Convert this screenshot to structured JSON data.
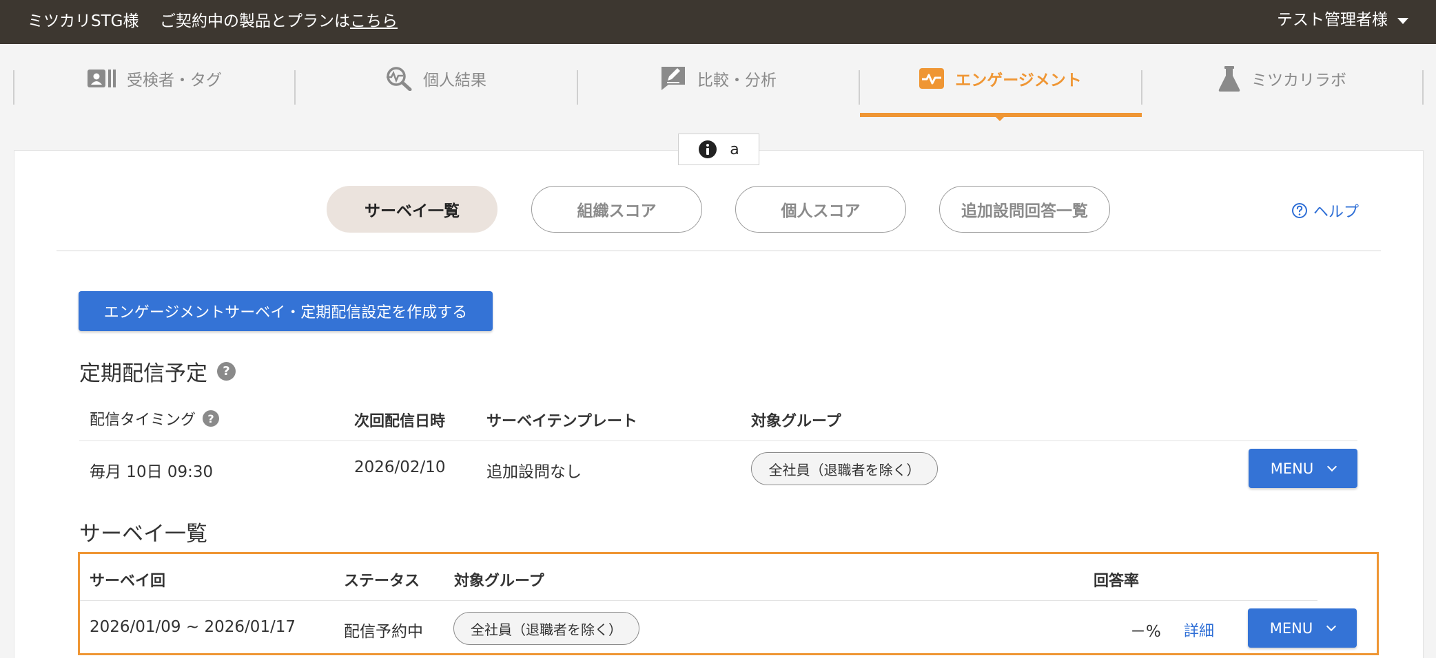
{
  "topbar": {
    "company": "ミツカリSTG様",
    "plan_text": "ご契約中の製品とプランは",
    "plan_link": "こちら",
    "user": "テスト管理者様"
  },
  "nav": {
    "tabs": [
      {
        "label": "受検者・タグ",
        "icon": "id-card-icon"
      },
      {
        "label": "個人結果",
        "icon": "magnify-pulse-icon"
      },
      {
        "label": "比較・分析",
        "icon": "chat-pencil-icon"
      },
      {
        "label": "エンゲージメント",
        "icon": "pulse-icon",
        "active": true
      },
      {
        "label": "ミツカリラボ",
        "icon": "flask-icon"
      }
    ]
  },
  "info_badge": {
    "text": "a"
  },
  "subtabs": [
    {
      "label": "サーベイ一覧",
      "active": true
    },
    {
      "label": "組織スコア"
    },
    {
      "label": "個人スコア"
    },
    {
      "label": "追加設問回答一覧"
    }
  ],
  "help_label": "ヘルプ",
  "create_button": "エンゲージメントサーベイ・定期配信設定を作成する",
  "schedule": {
    "title": "定期配信予定",
    "columns": [
      "配信タイミング",
      "次回配信日時",
      "サーベイテンプレート",
      "対象グループ"
    ],
    "rows": [
      {
        "timing": "毎月 10日 09:30",
        "next": "2026/02/10",
        "template": "追加設問なし",
        "group": "全社員（退職者を除く）",
        "menu": "MENU"
      }
    ]
  },
  "surveys": {
    "title": "サーベイ一覧",
    "columns": [
      "サーベイ回",
      "ステータス",
      "対象グループ",
      "回答率"
    ],
    "rows": [
      {
        "period": "2026/01/09 ~ 2026/01/17",
        "status": "配信予約中",
        "group": "全社員（退職者を除く）",
        "rate": "－%",
        "detail": "詳細",
        "menu": "MENU"
      }
    ]
  },
  "colors": {
    "accent": "#ef9634",
    "primary": "#3473d6",
    "topbar": "#3d3730"
  }
}
